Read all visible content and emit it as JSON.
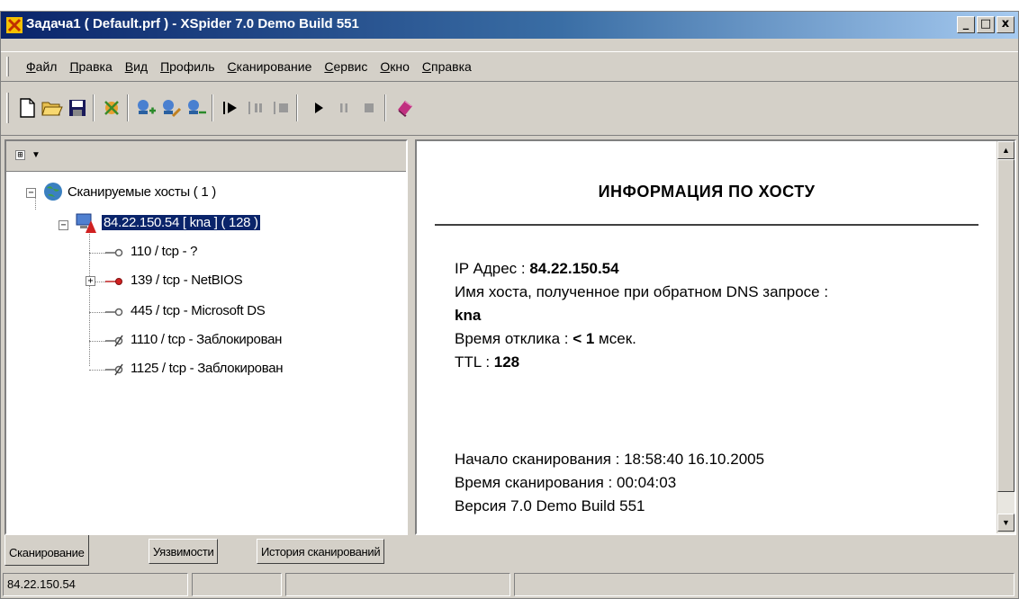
{
  "window": {
    "title": "Задача1 ( Default.prf ) - XSpider 7.0 Demo Build 551",
    "minimize": "_",
    "maximize": "□",
    "close": "x"
  },
  "menu": [
    "Файл",
    "Правка",
    "Вид",
    "Профиль",
    "Сканирование",
    "Сервис",
    "Окно",
    "Справка"
  ],
  "toolbar": {
    "icons": [
      "new-icon",
      "open-icon",
      "save-icon",
      "profile-icon",
      "add-host-icon",
      "edit-host-icon",
      "remove-host-icon",
      "step-icon",
      "pause-scan-icon",
      "stop-scan-icon",
      "play-icon",
      "pause-icon",
      "stop-icon",
      "help-book-icon"
    ]
  },
  "tree": {
    "expander": "⊞",
    "root": "Сканируемые хосты ( 1 )",
    "host": "84.22.150.54 [ kna ] ( 128 )",
    "ports": [
      {
        "label": "110 / tcp - ?",
        "state": "open"
      },
      {
        "label": "139 / tcp - NetBIOS",
        "state": "vulnerable"
      },
      {
        "label": "445 / tcp - Microsoft DS",
        "state": "open"
      },
      {
        "label": "1110 / tcp - Заблокирован",
        "state": "blocked"
      },
      {
        "label": "1125 / tcp - Заблокирован",
        "state": "blocked"
      }
    ]
  },
  "info": {
    "title": "ИНФОРМАЦИЯ ПО ХОСТУ",
    "ip_label": "IP Адрес : ",
    "ip_value": "84.22.150.54",
    "dns_label": "Имя хоста, полученное при обратном DNS запросе :",
    "dns_value": "kna",
    "response_label": "Время отклика : ",
    "response_value": "< 1",
    "response_unit": " мсек.",
    "ttl_label": "TTL : ",
    "ttl_value": "128",
    "scan_start_label": "Начало сканирования : ",
    "scan_start_value": "18:58:40 16.10.2005",
    "scan_time_label": "Время сканирования : ",
    "scan_time_value": "00:04:03",
    "version_label": "Версия 7.0 Demo Build 551"
  },
  "tabs": [
    "Сканирование",
    "Уязвимости",
    "История сканирований"
  ],
  "status": {
    "ip": "84.22.150.54"
  },
  "colors": {
    "title_start": "#0a246a",
    "title_end": "#a6caf0",
    "selection": "#0a246a",
    "face": "#d4d0c8"
  }
}
